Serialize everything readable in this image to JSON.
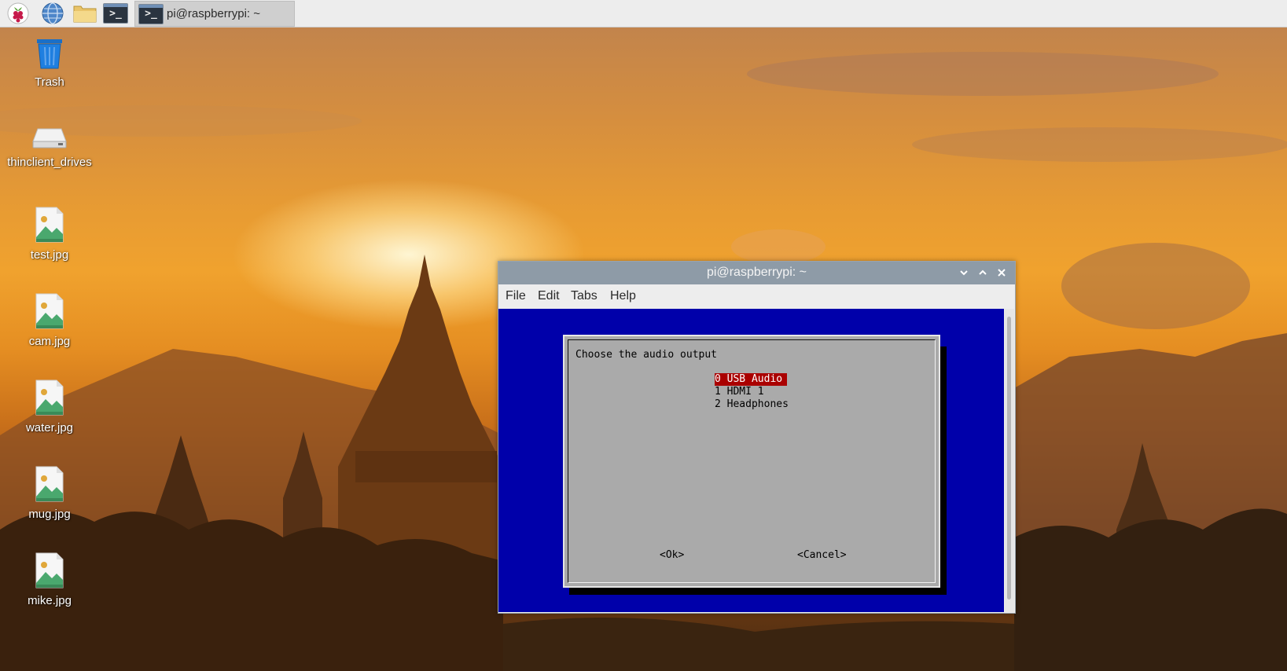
{
  "taskbar": {
    "launchers": [
      {
        "name": "raspberry-menu-icon"
      },
      {
        "name": "web-browser-icon"
      },
      {
        "name": "file-manager-icon"
      },
      {
        "name": "terminal-launcher-icon",
        "glyph": ">_"
      }
    ],
    "task": {
      "label": "pi@raspberrypi: ~",
      "glyph": ">_"
    }
  },
  "desktop": {
    "icons": [
      {
        "label": "Trash",
        "icon": "trash-icon"
      },
      {
        "label": "thinclient_drives",
        "icon": "drive-icon"
      },
      {
        "label": "test.jpg",
        "icon": "image-file-icon"
      },
      {
        "label": "cam.jpg",
        "icon": "image-file-icon"
      },
      {
        "label": "water.jpg",
        "icon": "image-file-icon"
      },
      {
        "label": "mug.jpg",
        "icon": "image-file-icon"
      },
      {
        "label": "mike.jpg",
        "icon": "image-file-icon"
      }
    ]
  },
  "window": {
    "title": "pi@raspberrypi: ~",
    "menu": [
      "File",
      "Edit",
      "Tabs",
      "Help"
    ],
    "controls": [
      "minimize-icon",
      "maximize-icon",
      "close-icon"
    ]
  },
  "dialog": {
    "prompt": "Choose the audio output",
    "options": [
      {
        "text": "0 USB Audio",
        "selected": true
      },
      {
        "text": "1 HDMI 1",
        "selected": false
      },
      {
        "text": "2 Headphones",
        "selected": false
      }
    ],
    "ok_label": "<Ok>",
    "cancel_label": "<Cancel>"
  },
  "colors": {
    "terminal_bg": "#0000aa",
    "dialog_bg": "#aaaaaa",
    "selection_bg": "#aa0000",
    "titlebar": "#8e9ba7"
  }
}
